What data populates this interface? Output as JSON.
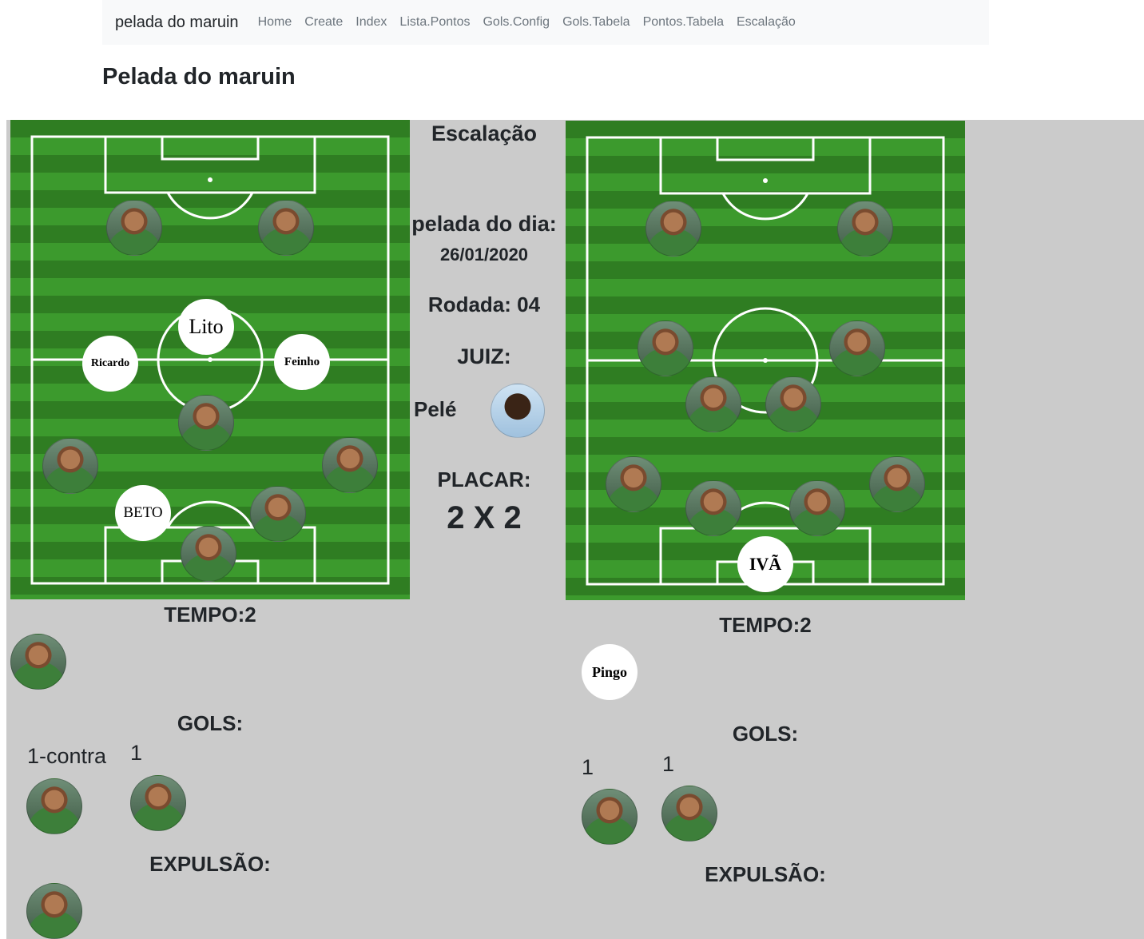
{
  "navbar": {
    "brand": "pelada do maruin",
    "links": [
      "Home",
      "Create",
      "Index",
      "Lista.Pontos",
      "Gols.Config",
      "Gols.Tabela",
      "Pontos.Tabela",
      "Escalação"
    ]
  },
  "page_title": "Pelada do maruin",
  "center": {
    "title": "Escalação",
    "date_label": "pelada do dia:",
    "date": "26/01/2020",
    "round": "Rodada: 04",
    "referee_label": "JUIZ:",
    "referee_name": "Pelé",
    "score_label": "PLACAR:",
    "score": "2 X 2"
  },
  "team_left": {
    "named_players": [
      "Lito",
      "Ricardo",
      "Feinho",
      "BETO"
    ],
    "tempo": "TEMPO:2",
    "goals_label": "GOLS:",
    "goal_counts": [
      "1-contra",
      "1"
    ],
    "expulsion_label": "EXPULSÃO:"
  },
  "team_right": {
    "named_players": [
      "IVÃ"
    ],
    "tempo": "TEMPO:2",
    "bench_player": "Pingo",
    "goals_label": "GOLS:",
    "goal_counts": [
      "1",
      "1"
    ],
    "expulsion_label": "EXPULSÃO:"
  },
  "colors": {
    "panel_bg": "#cbcbcb",
    "navbar_bg": "#f8f9fa",
    "grass_dark": "#2f7d22",
    "grass_light": "#3c9a2d"
  }
}
